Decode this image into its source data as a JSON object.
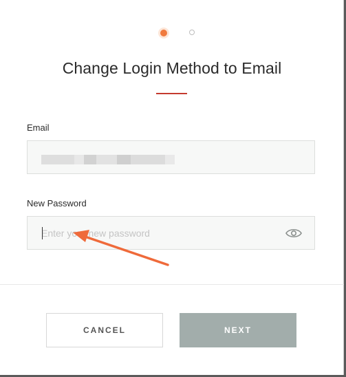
{
  "dialog": {
    "title": "Change Login Method to Email",
    "steps": {
      "total": 2,
      "current": 1
    },
    "accent_color": "#f07a3e",
    "rule_color": "#c43a2e"
  },
  "email": {
    "label": "Email",
    "value_obscured": true
  },
  "password": {
    "label": "New Password",
    "placeholder": "Enter your new password",
    "value": "",
    "toggle_icon": "eye-icon"
  },
  "actions": {
    "cancel_label": "CANCEL",
    "next_label": "NEXT",
    "next_color": "#a2adab"
  },
  "annotation": {
    "icon": "arrow-icon",
    "color": "#ef6a3a"
  }
}
